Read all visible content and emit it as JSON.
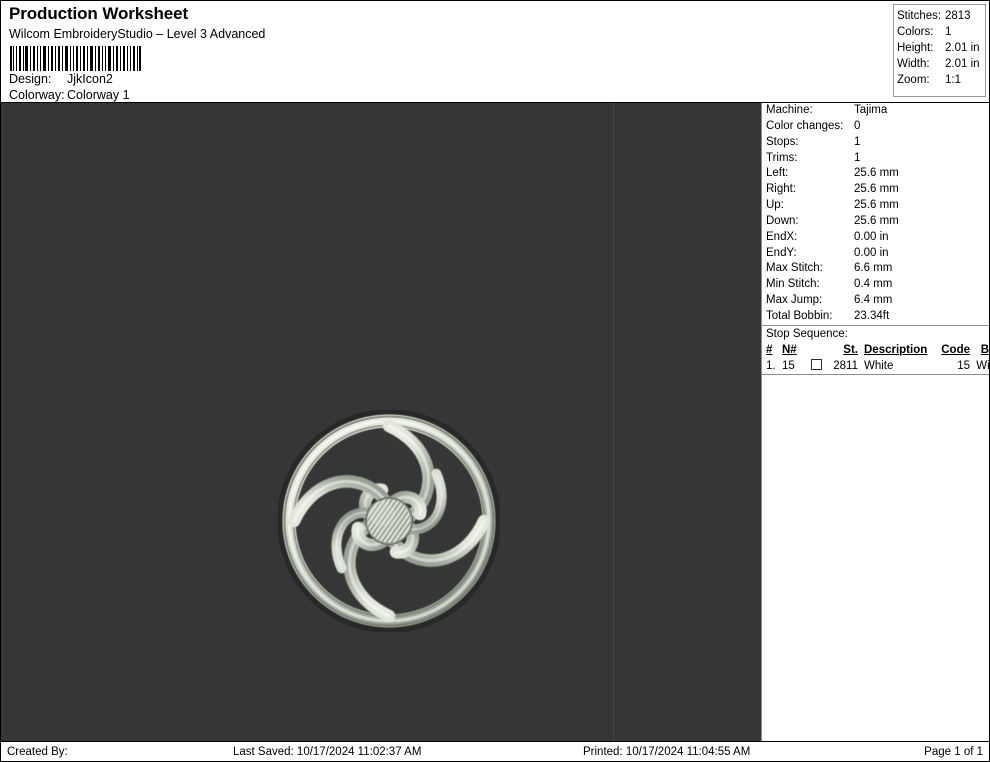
{
  "header": {
    "title": "Production Worksheet",
    "subtitle": "Wilcom EmbroideryStudio – Level 3 Advanced",
    "barcode_name": "barcode",
    "design_label": "Design:",
    "design_value": "JjkIcon2",
    "colorway_label": "Colorway:",
    "colorway_value": "Colorway 1"
  },
  "summary": [
    {
      "label": "Stitches:",
      "value": "2813"
    },
    {
      "label": "Colors:",
      "value": "1"
    },
    {
      "label": "Height:",
      "value": "2.01 in"
    },
    {
      "label": "Width:",
      "value": "2.01 in"
    },
    {
      "label": "Zoom:",
      "value": "1:1"
    }
  ],
  "info": [
    {
      "label": "Machine:",
      "value": "Tajima"
    },
    {
      "label": "Color changes:",
      "value": "0"
    },
    {
      "label": "Stops:",
      "value": "1"
    },
    {
      "label": "Trims:",
      "value": "1"
    },
    {
      "label": "Left:",
      "value": "25.6 mm"
    },
    {
      "label": "Right:",
      "value": "25.6 mm"
    },
    {
      "label": "Up:",
      "value": "25.6 mm"
    },
    {
      "label": "Down:",
      "value": "25.6 mm"
    },
    {
      "label": "EndX:",
      "value": "0.00 in"
    },
    {
      "label": "EndY:",
      "value": "0.00 in"
    },
    {
      "label": "Max Stitch:",
      "value": "6.6 mm"
    },
    {
      "label": "Min Stitch:",
      "value": "0.4 mm"
    },
    {
      "label": "Max Jump:",
      "value": "6.4 mm"
    },
    {
      "label": "Total Bobbin:",
      "value": "23.34ft"
    }
  ],
  "stop_sequence": {
    "title": "Stop Sequence:",
    "columns": [
      "#",
      "N#",
      "",
      "St.",
      "Description",
      "Code",
      "Brand"
    ],
    "rows": [
      {
        "num": "1.",
        "nnum": "15",
        "swatch_color": "#ffffff",
        "stitches": "2811",
        "description": "White",
        "code": "15",
        "brand": "Wilcom"
      }
    ]
  },
  "canvas": {
    "background_color": "#363636",
    "divider_color": "#474747",
    "thread_color": "#e9ece1",
    "design_name": "JjkIcon2 spiral knot embroidery"
  },
  "footer": {
    "created_by": "Created By:",
    "last_saved": "Last Saved: 10/17/2024 11:02:37 AM",
    "printed": "Printed: 10/17/2024 11:04:55 AM",
    "page": "Page 1 of 1"
  }
}
